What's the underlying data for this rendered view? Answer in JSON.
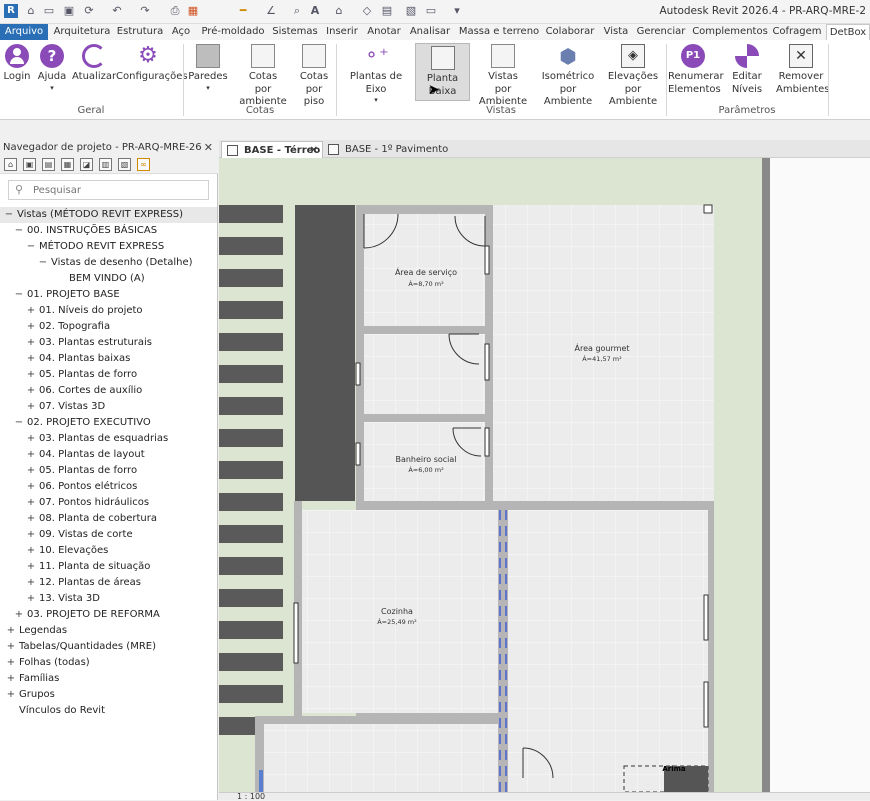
{
  "app": {
    "title": "Autodesk Revit 2026.4 - PR-ARQ-MRE-2"
  },
  "ribbon_tabs": [
    "Arquivo",
    "Arquitetura",
    "Estrutura",
    "Aço",
    "Pré-moldado",
    "Sistemas",
    "Inserir",
    "Anotar",
    "Analisar",
    "Massa e terreno",
    "Colaborar",
    "Vista",
    "Gerenciar",
    "Complementos",
    "Cofragem",
    "DetBox"
  ],
  "ribbon": {
    "buttons": {
      "login": "Login",
      "ajuda": "Ajuda",
      "atualizar": "Atualizar",
      "config": "Configurações",
      "paredes": "Paredes",
      "cotas_amb_1": "Cotas",
      "cotas_amb_2": "por ambiente",
      "cotas_piso_1": "Cotas",
      "cotas_piso_2": "por piso",
      "plantas_eixo": "Plantas de Eixo",
      "planta_baixa": "Planta Baixa",
      "vistas_amb_1": "Vistas",
      "vistas_amb_2": "por Ambiente",
      "iso_1": "Isométrico",
      "iso_2": "por Ambiente",
      "elev_1": "Elevações",
      "elev_2": "por Ambiente",
      "renum_1": "Renumerar",
      "renum_2": "Elementos",
      "editar_niveis": "Editar Níveis",
      "remover_1": "Remover",
      "remover_2": "Ambientes",
      "p1_badge": "P1"
    },
    "panels": {
      "geral": "Geral",
      "cotas": "Cotas",
      "vistas": "Vistas",
      "parametros": "Parâmetros"
    }
  },
  "browser": {
    "title": "Navegador de projeto - PR-ARQ-MRE-26",
    "search_placeholder": "Pesquisar",
    "tree": [
      {
        "label": "Vistas (MÉTODO REVIT EXPRESS)",
        "exp": "−",
        "level": 0
      },
      {
        "label": "00. INSTRUÇÕES BÁSICAS",
        "exp": "−",
        "level": 1
      },
      {
        "label": "MÉTODO REVIT EXPRESS",
        "exp": "−",
        "level": 2
      },
      {
        "label": "Vistas de desenho (Detalhe)",
        "exp": "−",
        "level": 3
      },
      {
        "label": "BEM VINDO (A)",
        "exp": "",
        "level": 4
      },
      {
        "label": "01. PROJETO BASE",
        "exp": "−",
        "level": 1
      },
      {
        "label": "01. Níveis do projeto",
        "exp": "+",
        "level": 2
      },
      {
        "label": "02. Topografia",
        "exp": "+",
        "level": 2
      },
      {
        "label": "03. Plantas estruturais",
        "exp": "+",
        "level": 2
      },
      {
        "label": "04. Plantas baixas",
        "exp": "+",
        "level": 2
      },
      {
        "label": "05. Plantas de forro",
        "exp": "+",
        "level": 2
      },
      {
        "label": "06. Cortes de auxílio",
        "exp": "+",
        "level": 2
      },
      {
        "label": "07. Vistas 3D",
        "exp": "+",
        "level": 2
      },
      {
        "label": "02. PROJETO EXECUTIVO",
        "exp": "−",
        "level": 1
      },
      {
        "label": "03. Plantas de esquadrias",
        "exp": "+",
        "level": 2
      },
      {
        "label": "04. Plantas de layout",
        "exp": "+",
        "level": 2
      },
      {
        "label": "05. Plantas de forro",
        "exp": "+",
        "level": 2
      },
      {
        "label": "06. Pontos elétricos",
        "exp": "+",
        "level": 2
      },
      {
        "label": "07. Pontos hidráulicos",
        "exp": "+",
        "level": 2
      },
      {
        "label": "08. Planta de cobertura",
        "exp": "+",
        "level": 2
      },
      {
        "label": "09. Vistas de corte",
        "exp": "+",
        "level": 2
      },
      {
        "label": "10. Elevações",
        "exp": "+",
        "level": 2
      },
      {
        "label": "11. Planta de situação",
        "exp": "+",
        "level": 2
      },
      {
        "label": "12. Plantas de áreas",
        "exp": "+",
        "level": 2
      },
      {
        "label": "13. Vista 3D",
        "exp": "+",
        "level": 2
      },
      {
        "label": "03. PROJETO DE REFORMA",
        "exp": "+",
        "level": 1
      },
      {
        "label": "Legendas",
        "exp": "+",
        "level": 0
      },
      {
        "label": "Tabelas/Quantidades (MRE)",
        "exp": "+",
        "level": 0
      },
      {
        "label": "Folhas (todas)",
        "exp": "+",
        "level": 0
      },
      {
        "label": "Famílias",
        "exp": "+",
        "level": 0
      },
      {
        "label": "Grupos",
        "exp": "+",
        "level": 0
      },
      {
        "label": "Vínculos do Revit",
        "exp": "",
        "level": 0
      }
    ]
  },
  "doc_tabs": [
    {
      "label": "BASE - Térreo",
      "active": true,
      "close": "✕"
    },
    {
      "label": "BASE - 1º Pavimento",
      "active": false,
      "close": ""
    }
  ],
  "plan": {
    "rooms": {
      "servico_name": "Área de serviço",
      "servico_area": "Á=8,70 m²",
      "gourmet_name": "Área gourmet",
      "gourmet_area": "Á=41,57 m²",
      "banheiro_name": "Banheiro social",
      "banheiro_area": "Á=6,00 m²",
      "cozinha_name": "Cozinha",
      "cozinha_area": "Á=25,49 m²"
    },
    "arrow_label": "Arima"
  },
  "status": {
    "scale": "1 : 100"
  }
}
